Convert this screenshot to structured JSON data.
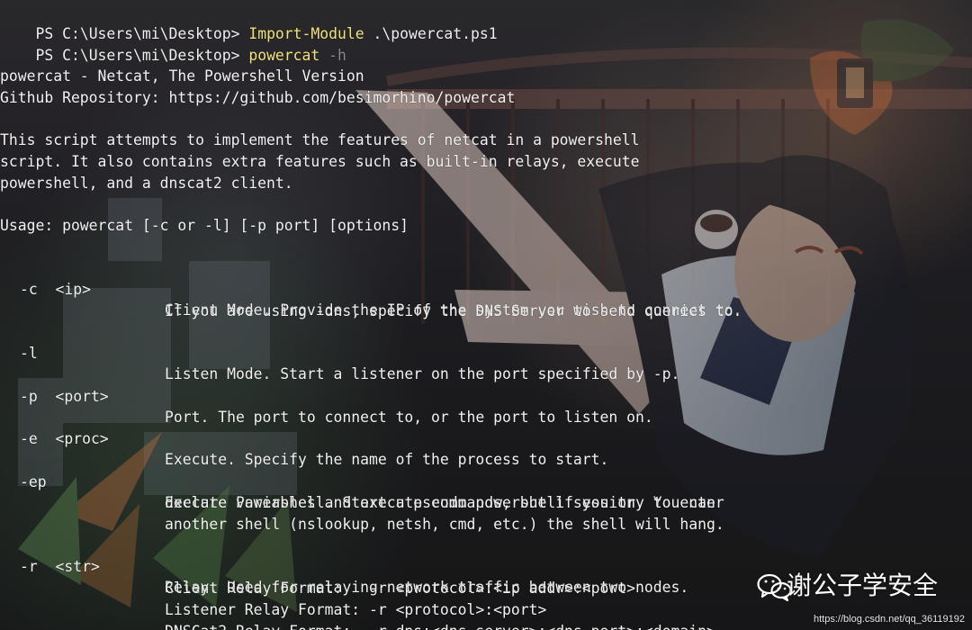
{
  "terminal": {
    "prompt_1": "PS C:\\Users\\mi\\Desktop> ",
    "command_1_name": "Import-Module",
    "command_1_args": " .\\powercat.ps1",
    "prompt_2": "PS C:\\Users\\mi\\Desktop> ",
    "command_2_name": "powercat",
    "command_2_arg": " -h",
    "title_line": "powercat - Netcat, The Powershell Version",
    "repo_line": "Github Repository: https://github.com/besimorhino/powercat",
    "description_lines": [
      "This script attempts to implement the features of netcat in a powershell",
      "script. It also contains extra features such as built-in relays, execute",
      "powershell, and a dnscat2 client."
    ],
    "usage_line": "Usage: powercat [-c or -l] [-p port] [options]",
    "options": [
      {
        "flag": "-c  <ip>",
        "lines": [
          "Client Mode. Provide the IP of the system you wish to connect to.",
          "If you are using -dns, specify the DNS Server to send queries to."
        ]
      },
      {
        "flag": "-l",
        "lines": [
          "Listen Mode. Start a listener on the port specified by -p."
        ]
      },
      {
        "flag": "-p  <port>",
        "lines": [
          "Port. The port to connect to, or the port to listen on."
        ]
      },
      {
        "flag": "-e  <proc>",
        "lines": [
          "Execute. Specify the name of the process to start."
        ]
      },
      {
        "flag": "-ep",
        "lines": [
          "Execute Powershell. Start a pseudo powershell session. You can",
          "declare variables and execute commands, but if you try to enter",
          "another shell (nslookup, netsh, cmd, etc.) the shell will hang."
        ]
      },
      {
        "flag": "-r  <str>",
        "lines": [
          "Relay. Used for relaying network traffic between two nodes.",
          "Client Relay Format:   -r <protocol>:<ip addr>:<port>",
          "Listener Relay Format: -r <protocol>:<port>",
          "DNSCat2 Relay Format:  -r dns:<dns server>:<dns port>:<domain>"
        ]
      }
    ]
  },
  "watermark": {
    "main_text": "谢公子学安全",
    "url_text": "https://blog.csdn.net/qq_36119192",
    "icon": "wechat-icon"
  },
  "colors": {
    "terminal_text": "#f3f3f3",
    "command_highlight": "#f2e47b",
    "argument_muted": "#8a8a8a"
  }
}
